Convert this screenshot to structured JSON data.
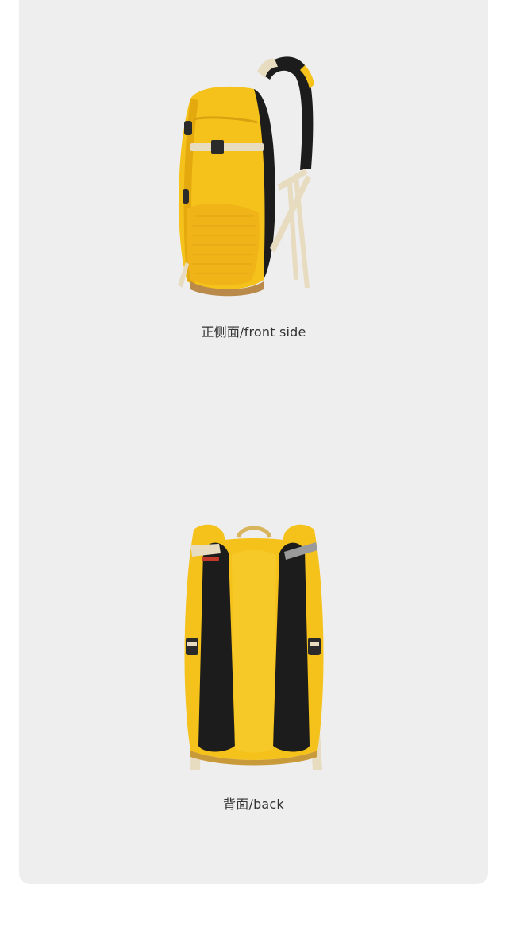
{
  "views": {
    "side": {
      "caption": "正侧面/front side",
      "image_alt": "yellow-backpack-side-view"
    },
    "back": {
      "caption": "背面/back",
      "image_alt": "yellow-backpack-back-view"
    }
  },
  "colors": {
    "panel_background": "#efeeef",
    "backpack_yellow": "#f5c21b",
    "backpack_shade": "#e3a90f",
    "strap_black": "#1c1c1c",
    "webbing_beige": "#e8dcc0"
  }
}
